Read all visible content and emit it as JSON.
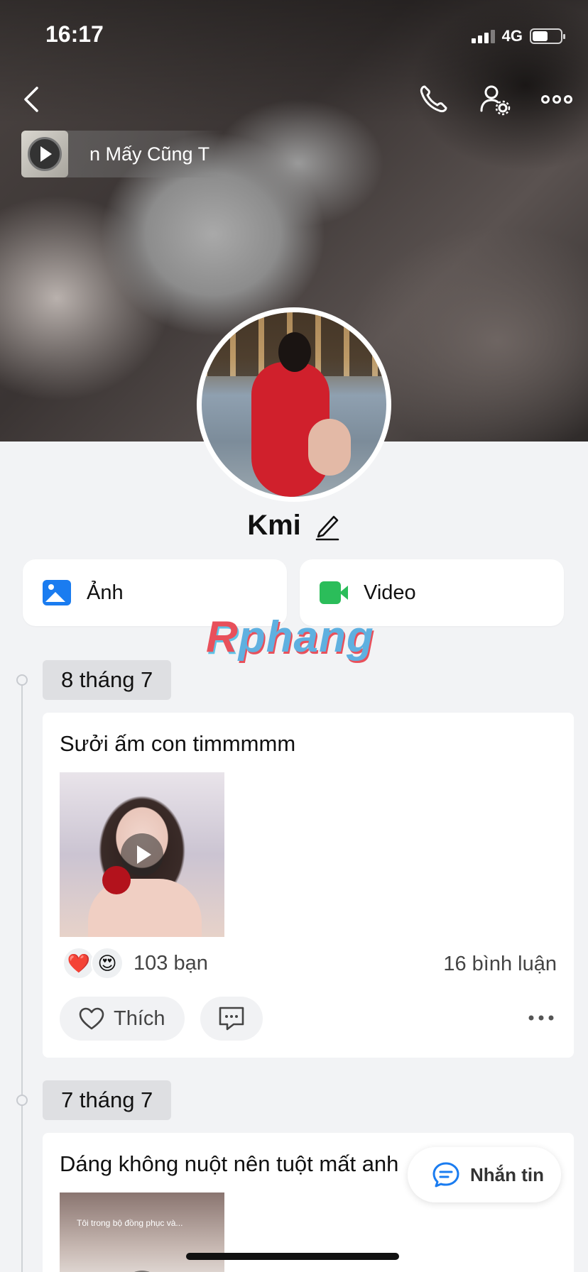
{
  "status_bar": {
    "time": "16:17",
    "network": "4G",
    "battery_percent": 55,
    "signal_bars_filled": 3
  },
  "header": {
    "music_title": "n Mấy Cũng T",
    "icons": [
      "back-icon",
      "phone-icon",
      "user-settings-icon",
      "more-icon"
    ]
  },
  "profile": {
    "name": "Kmi"
  },
  "quick_actions": {
    "photos_label": "Ảnh",
    "videos_label": "Video"
  },
  "watermark": {
    "part1": "R",
    "part2": "phang"
  },
  "timeline": [
    {
      "date": "8 tháng 7",
      "caption": "Sưởi ấm con timmmmm",
      "reactions": [
        "❤️",
        "😍"
      ],
      "reaction_count": "103 bạn",
      "comment_count": "16 bình luận",
      "like_label": "Thích"
    },
    {
      "date": "7 tháng 7",
      "caption": "Dáng không nuột nên tuột mất anh",
      "media_text": "Tôi trong bộ đồng phục và..."
    }
  ],
  "message_button": {
    "label": "Nhắn tin"
  },
  "colors": {
    "accent": "#1a7cf0",
    "video_green": "#2bbd5a",
    "background": "#f2f3f5"
  }
}
